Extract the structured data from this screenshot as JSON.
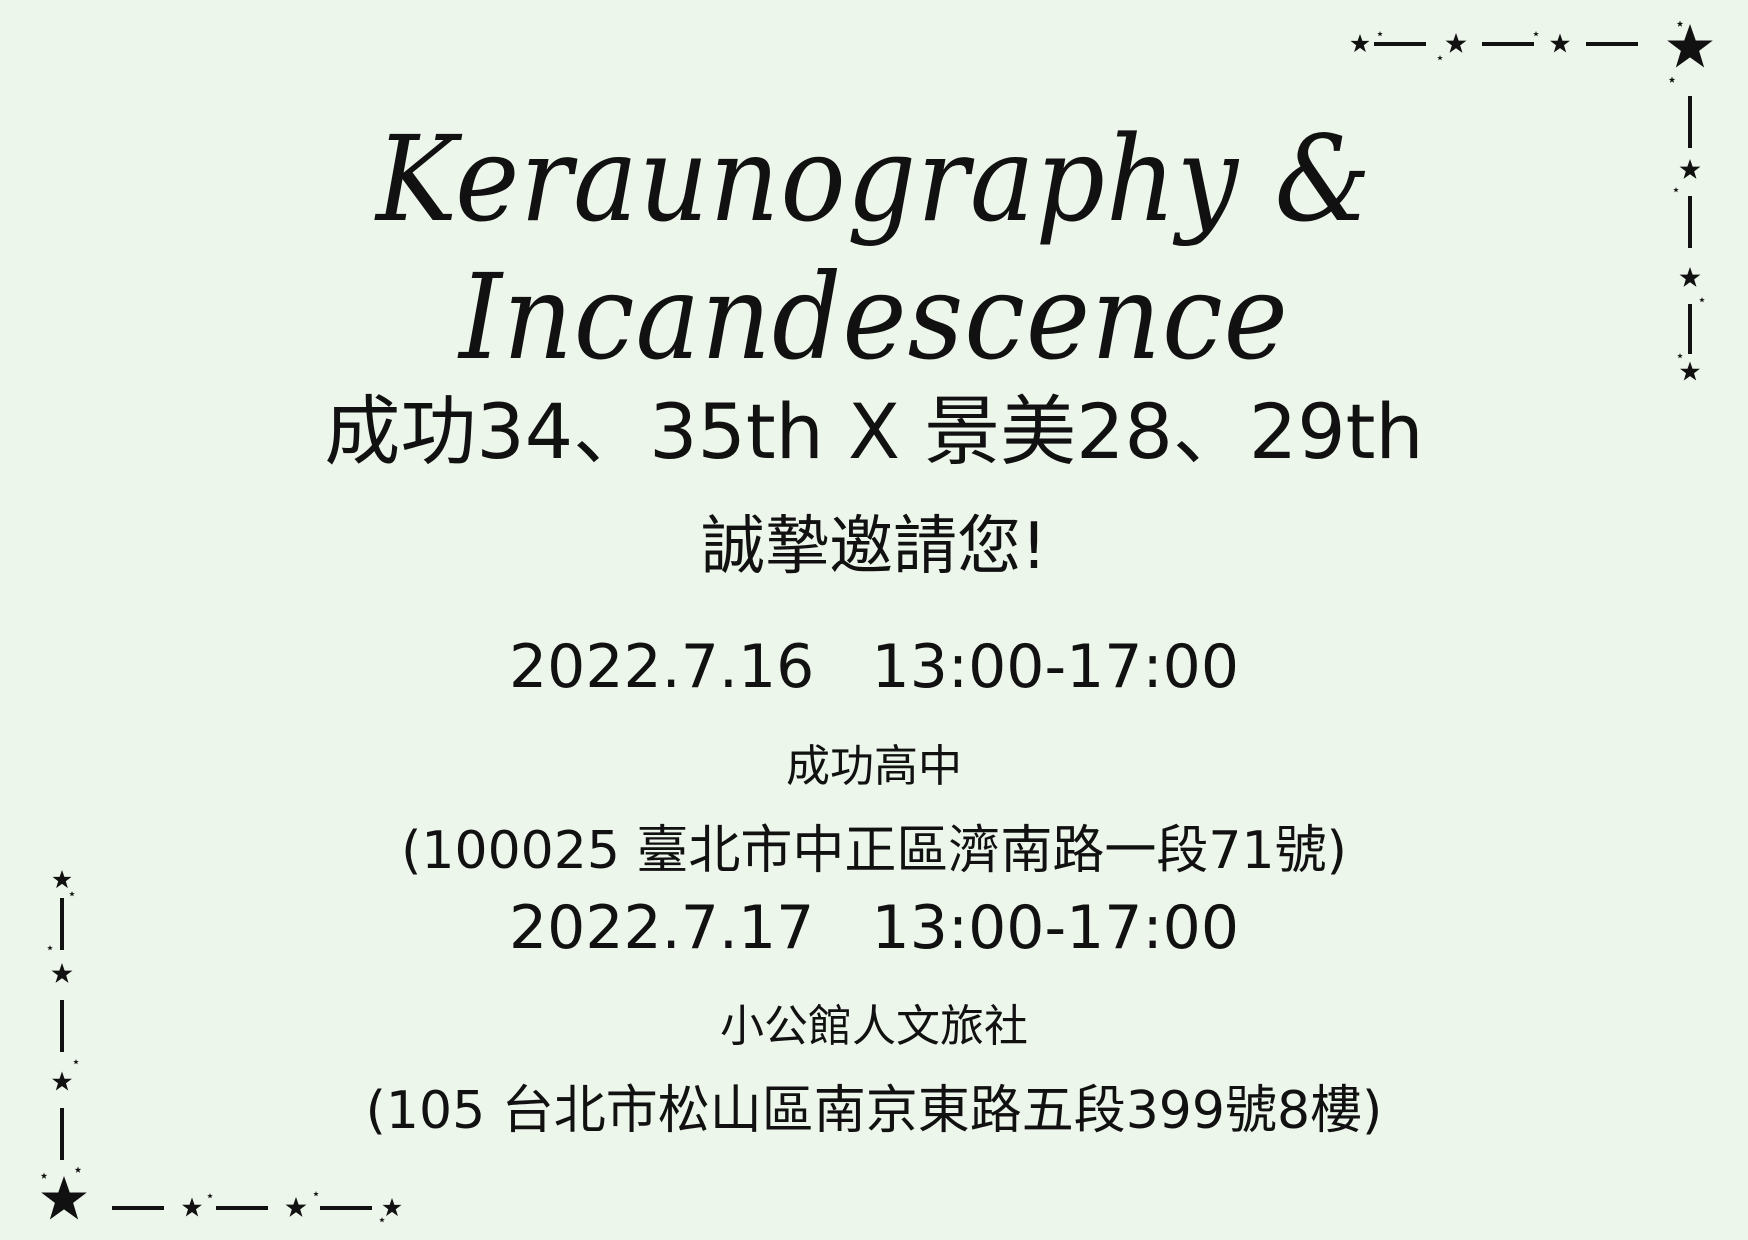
{
  "invitation": {
    "script_title": "Keraunography & Incandescence",
    "schools_line": "成功34、35th X 景美28、29th",
    "invite_line": "誠摯邀請您!",
    "events": [
      {
        "datetime": "2022.7.16   13:00-17:00",
        "venue": "成功高中",
        "address": "(100025 臺北市中正區濟南路一段71號)"
      },
      {
        "datetime": "2022.7.17   13:00-17:00",
        "venue": "小公館人文旅社",
        "address": "(105 台北市松山區南京東路五段399號8樓)"
      }
    ]
  },
  "decor": {
    "corner_border_icon": "star-line-border-icon",
    "ink_color": "#111111",
    "background_color": "#edf6ea"
  }
}
